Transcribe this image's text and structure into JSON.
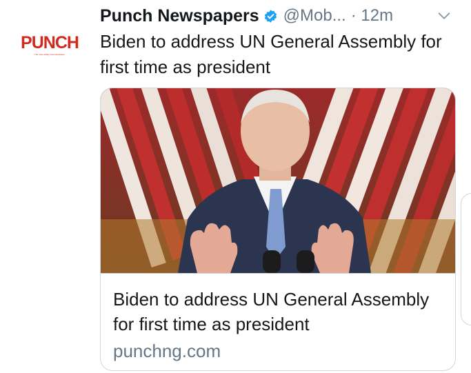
{
  "tweet": {
    "display_name": "Punch Newspapers",
    "handle": "@Mob...",
    "separator": "·",
    "time": "12m",
    "text": "Biden to address UN General Assembly for first time as president",
    "verified": true
  },
  "avatar": {
    "logo_text": "PUNCH",
    "tagline": "The most widely read newspaper"
  },
  "card": {
    "title": "Biden to address UN General Assembly for first time as president",
    "domain": "punchng.com",
    "image_description": "man speaking at podium with flags"
  },
  "icons": {
    "verified": "verified-badge-icon",
    "more": "chevron-down-icon"
  },
  "colors": {
    "brand_red": "#d12a1f",
    "verified_blue": "#1da1f2",
    "text": "#14171a",
    "secondary_text": "#657786",
    "border": "#cfd9de"
  }
}
